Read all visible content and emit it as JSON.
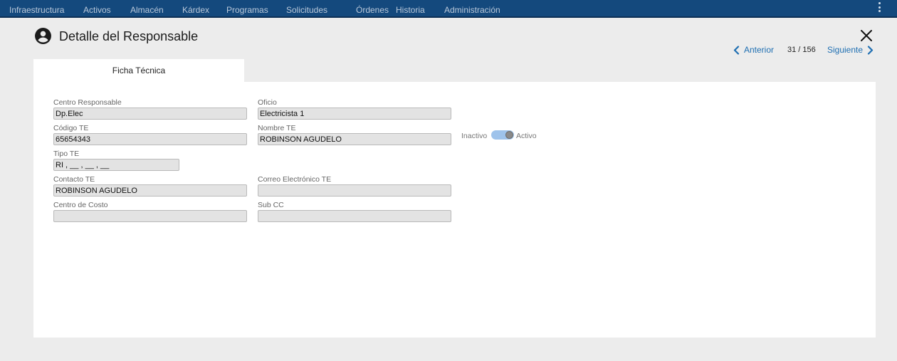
{
  "nav": {
    "items": [
      "Infraestructura",
      "Activos",
      "Almacén",
      "Kárdex",
      "Programas",
      "Solicitudes",
      "Órdenes",
      "Historia",
      "Administración"
    ],
    "menu_icon": "kebab-menu-icon"
  },
  "header": {
    "title": "Detalle del Responsable",
    "icon": "account-circle-icon",
    "close_icon": "close-icon"
  },
  "pager": {
    "prev_label": "Anterior",
    "count": "31 / 156",
    "next_label": "Siguiente"
  },
  "tabs": [
    "Ficha Técnica"
  ],
  "form": {
    "centro_responsable": {
      "label": "Centro Responsable",
      "value": "Dp.Elec"
    },
    "oficio": {
      "label": "Oficio",
      "value": "Electricista 1"
    },
    "codigo_te": {
      "label": "Código TE",
      "value": "65654343"
    },
    "nombre_te": {
      "label": "Nombre TE",
      "value": "ROBINSON AGUDELO"
    },
    "tipo_te": {
      "label": "Tipo TE",
      "value": "RI , __ , __ , __"
    },
    "contacto_te": {
      "label": "Contacto TE",
      "value": "ROBINSON AGUDELO"
    },
    "correo_te": {
      "label": "Correo Electrónico TE",
      "value": ""
    },
    "centro_costo": {
      "label": "Centro de Costo",
      "value": ""
    },
    "sub_cc": {
      "label": "Sub CC",
      "value": ""
    }
  },
  "status_toggle": {
    "off_label": "Inactivo",
    "on_label": "Activo",
    "state": "on"
  },
  "colors": {
    "nav_bg": "#14497d",
    "accent": "#1f6fb2",
    "toggle_track": "#9ec3eb"
  }
}
